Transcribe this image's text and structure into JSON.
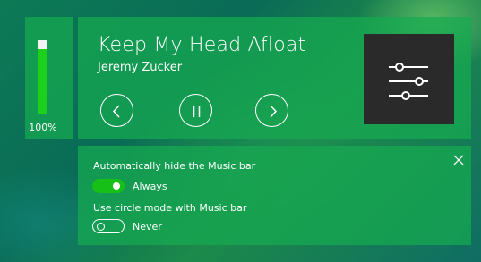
{
  "volume": {
    "percent_label": "100%",
    "level": 1.0
  },
  "now_playing": {
    "title": "Keep My Head Afloat",
    "artist": "Jeremy Zucker"
  },
  "controls": {
    "previous_icon": "chevron-left-icon",
    "pause_icon": "pause-icon",
    "next_icon": "chevron-right-icon"
  },
  "album_art": {
    "icon": "equalizer-sliders-icon"
  },
  "settings": {
    "close_icon": "close-icon",
    "auto_hide": {
      "label": "Automatically hide the Music bar",
      "value": "Always",
      "enabled": true
    },
    "circle_mode": {
      "label": "Use circle mode with Music bar",
      "value": "Never",
      "enabled": false
    }
  },
  "colors": {
    "panel": "#16aa50",
    "toggle_on": "#16c016",
    "volume_fill": "#1cd11c"
  }
}
